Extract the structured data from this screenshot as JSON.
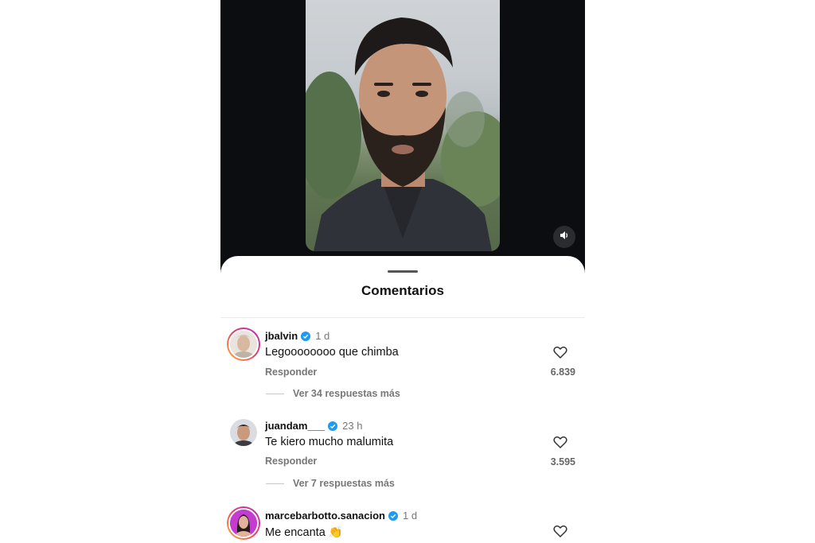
{
  "sheet": {
    "title": "Comentarios"
  },
  "icons": {
    "volume": "volume-icon",
    "verified": "verified-badge-icon",
    "like": "heart-icon"
  },
  "colors": {
    "verified": "#1d9bf0",
    "video_bg": "#0c0d10"
  },
  "comments": [
    {
      "username": "jbalvin",
      "verified": true,
      "time": "1 d",
      "text": "Legoooooooo que chimba",
      "reply_label": "Responder",
      "likes": "6.839",
      "more_replies": "Ver 34 respuestas más",
      "story_ring": true
    },
    {
      "username": "juandam___",
      "verified": true,
      "time": "23 h",
      "text": "Te kiero mucho malumita",
      "reply_label": "Responder",
      "likes": "3.595",
      "more_replies": "Ver 7 respuestas más",
      "story_ring": false
    },
    {
      "username": "marcebarbotto.sanacion",
      "verified": true,
      "time": "1 d",
      "text": "Me encanta 👏",
      "story_ring": true
    }
  ]
}
